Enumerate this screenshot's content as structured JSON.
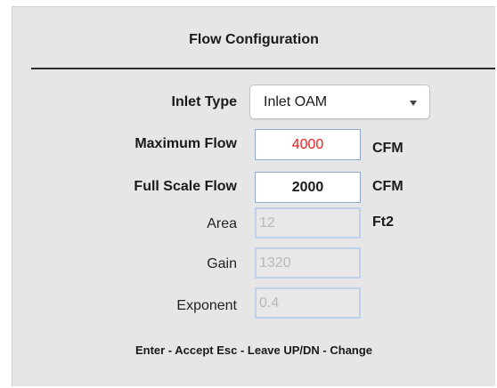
{
  "title": "Flow Configuration",
  "inlet_type": {
    "label": "Inlet Type",
    "value": "Inlet OAM"
  },
  "maximum_flow": {
    "label": "Maximum Flow",
    "value": "4000",
    "unit": "CFM",
    "value_color": "#ee1c1c"
  },
  "full_scale_flow": {
    "label": "Full Scale Flow",
    "value": "2000",
    "unit": "CFM"
  },
  "area": {
    "label": "Area",
    "value": "12",
    "unit": "Ft2"
  },
  "gain": {
    "label": "Gain",
    "value": "1320"
  },
  "exponent": {
    "label": "Exponent",
    "value": "0.4"
  },
  "help_text": "Enter - Accept Esc - Leave UP/DN - Change",
  "icons": {
    "dropdown": "chevron-down-icon"
  }
}
